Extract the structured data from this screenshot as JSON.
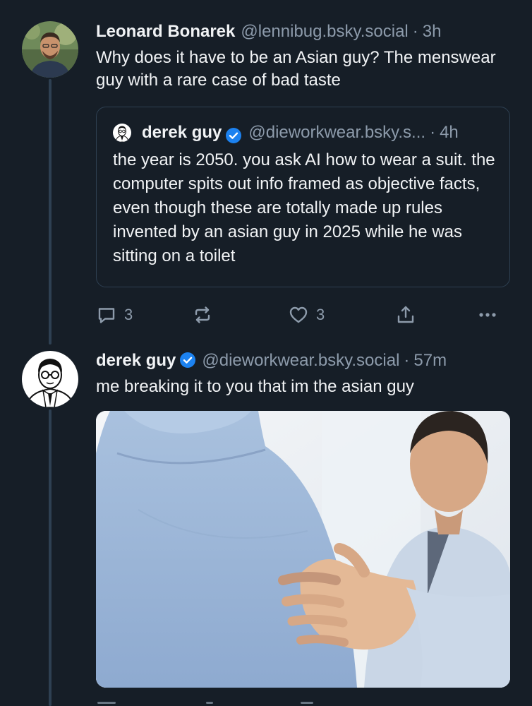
{
  "thread": {
    "reply_post": {
      "author_name": "Leonard Bonarek",
      "author_handle": "@lennibug.bsky.social",
      "separator": "·",
      "time": "3h",
      "text": "Why does it have to be an Asian guy? The menswear guy with a rare case of bad taste",
      "quote": {
        "author_name": "derek guy",
        "author_handle": "@dieworkwear.bsky.s...",
        "separator": "·",
        "time": "4h",
        "verified": true,
        "text": "the year is 2050. you ask AI how to wear a suit. the computer spits out info framed as objective facts, even though these are totally made up rules invented by an asian guy in 2025 while he was sitting on a toilet"
      },
      "actions": {
        "reply_count": "3",
        "like_count": "3"
      }
    },
    "main_post": {
      "author_name": "derek guy",
      "author_handle": "@dieworkwear.bsky.social",
      "separator": "·",
      "time": "57m",
      "verified": true,
      "text": "me breaking it to you that im the asian guy"
    }
  },
  "icons": {
    "reply": "reply-icon",
    "repost": "repost-icon",
    "like": "heart-icon",
    "share": "share-icon",
    "more": "more-options-icon",
    "verified": "verified-check-icon"
  },
  "colors": {
    "background": "#161e27",
    "text": "#f1f3f5",
    "muted": "#8d9bab",
    "border": "#2e4052",
    "verified_blue": "#1c82f0"
  }
}
